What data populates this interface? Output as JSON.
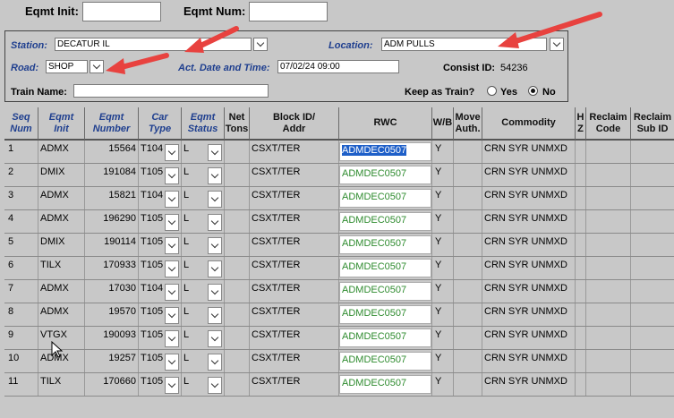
{
  "top": {
    "eqmt_init_label": "Eqmt Init:",
    "eqmt_init_value": "",
    "eqmt_num_label": "Eqmt Num:",
    "eqmt_num_value": ""
  },
  "panel": {
    "station_label": "Station:",
    "station_value": "DECATUR IL",
    "location_label": "Location:",
    "location_value": "ADM PULLS",
    "road_label": "Road:",
    "road_value": "SHOP",
    "act_label": "Act. Date and Time:",
    "act_value": "07/02/24 09:00",
    "consist_label": "Consist ID:",
    "consist_value": "54236",
    "train_label": "Train Name:",
    "train_value": "",
    "keep_label": "Keep as Train?",
    "yes_label": "Yes",
    "no_label": "No",
    "keep_selected": "No"
  },
  "table": {
    "headers": {
      "seq": [
        "Seq",
        "Num"
      ],
      "init": [
        "Eqmt",
        "Init"
      ],
      "number": [
        "Eqmt",
        "Number"
      ],
      "cartype": [
        "Car",
        "Type"
      ],
      "status": [
        "Eqmt",
        "Status"
      ],
      "tons": [
        "Net",
        "Tons"
      ],
      "block": [
        "Block ID/",
        "Addr"
      ],
      "rwc": [
        "RWC"
      ],
      "wb": [
        "W/B"
      ],
      "move": [
        "Move",
        "Auth."
      ],
      "commodity": [
        "Commodity"
      ],
      "hz": [
        "H",
        "Z"
      ],
      "reclaim_code": [
        "Reclaim",
        "Code"
      ],
      "reclaim_sub": [
        "Reclaim",
        "Sub ID"
      ]
    },
    "rows": [
      {
        "seq": "1",
        "init": "ADMX",
        "number": "15564",
        "type": "T104",
        "status": "L",
        "block": "CSXT/TER",
        "rwc": "ADMDEC0507",
        "wb": "Y",
        "commodity": "CRN SYR UNMXD"
      },
      {
        "seq": "2",
        "init": "DMIX",
        "number": "191084",
        "type": "T105",
        "status": "L",
        "block": "CSXT/TER",
        "rwc": "ADMDEC0507",
        "wb": "Y",
        "commodity": "CRN SYR UNMXD"
      },
      {
        "seq": "3",
        "init": "ADMX",
        "number": "15821",
        "type": "T104",
        "status": "L",
        "block": "CSXT/TER",
        "rwc": "ADMDEC0507",
        "wb": "Y",
        "commodity": "CRN SYR UNMXD"
      },
      {
        "seq": "4",
        "init": "ADMX",
        "number": "196290",
        "type": "T105",
        "status": "L",
        "block": "CSXT/TER",
        "rwc": "ADMDEC0507",
        "wb": "Y",
        "commodity": "CRN SYR UNMXD"
      },
      {
        "seq": "5",
        "init": "DMIX",
        "number": "190114",
        "type": "T105",
        "status": "L",
        "block": "CSXT/TER",
        "rwc": "ADMDEC0507",
        "wb": "Y",
        "commodity": "CRN SYR UNMXD"
      },
      {
        "seq": "6",
        "init": "TILX",
        "number": "170933",
        "type": "T105",
        "status": "L",
        "block": "CSXT/TER",
        "rwc": "ADMDEC0507",
        "wb": "Y",
        "commodity": "CRN SYR UNMXD"
      },
      {
        "seq": "7",
        "init": "ADMX",
        "number": "17030",
        "type": "T104",
        "status": "L",
        "block": "CSXT/TER",
        "rwc": "ADMDEC0507",
        "wb": "Y",
        "commodity": "CRN SYR UNMXD"
      },
      {
        "seq": "8",
        "init": "ADMX",
        "number": "19570",
        "type": "T105",
        "status": "L",
        "block": "CSXT/TER",
        "rwc": "ADMDEC0507",
        "wb": "Y",
        "commodity": "CRN SYR UNMXD"
      },
      {
        "seq": "9",
        "init": "VTGX",
        "number": "190093",
        "type": "T105",
        "status": "L",
        "block": "CSXT/TER",
        "rwc": "ADMDEC0507",
        "wb": "Y",
        "commodity": "CRN SYR UNMXD"
      },
      {
        "seq": "10",
        "init": "ADMX",
        "number": "19257",
        "type": "T105",
        "status": "L",
        "block": "CSXT/TER",
        "rwc": "ADMDEC0507",
        "wb": "Y",
        "commodity": "CRN SYR UNMXD"
      },
      {
        "seq": "11",
        "init": "TILX",
        "number": "170660",
        "type": "T105",
        "status": "L",
        "block": "CSXT/TER",
        "rwc": "ADMDEC0507",
        "wb": "Y",
        "commodity": "CRN SYR UNMXD"
      }
    ]
  },
  "colors": {
    "background": "#c8c8c8",
    "label_navy": "#1f3f8f",
    "rwc_text": "#2e8b2e",
    "selection": "#1e5fc8",
    "annotation_arrow": "#e8423f"
  },
  "icons": {
    "dropdown": "chevron-down-icon",
    "annotation": "red-arrow-icon",
    "cursor": "mouse-pointer-icon"
  }
}
